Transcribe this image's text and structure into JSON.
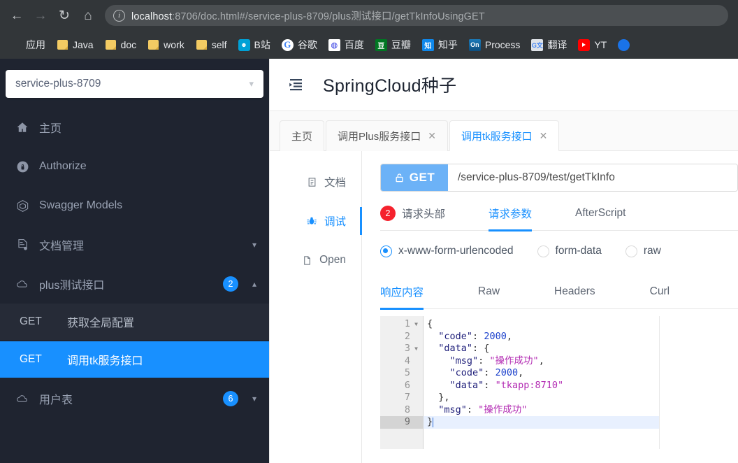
{
  "browser": {
    "back_icon": "back-arrow-icon",
    "forward_icon": "forward-arrow-icon",
    "reload_icon": "reload-icon",
    "home_icon": "home-icon",
    "url_host": "localhost",
    "url_rest": ":8706/doc.html#/service-plus-8709/plus测试接口/getTkInfoUsingGET",
    "url_full": "localhost:8706/doc.html#/service-plus-8709/plus测试接口/getTkInfoUsingGET",
    "site_info_icon": "info-circle-icon",
    "bookmarks": [
      {
        "label": "应用",
        "icon": "apps-grid-icon"
      },
      {
        "label": "Java",
        "icon": "folder-icon"
      },
      {
        "label": "doc",
        "icon": "folder-icon"
      },
      {
        "label": "work",
        "icon": "folder-icon"
      },
      {
        "label": "self",
        "icon": "folder-icon"
      },
      {
        "label": "B站",
        "icon": "bilibili-icon"
      },
      {
        "label": "谷歌",
        "icon": "google-icon"
      },
      {
        "label": "百度",
        "icon": "baidu-icon"
      },
      {
        "label": "豆瓣",
        "icon": "douban-icon"
      },
      {
        "label": "知乎",
        "icon": "zhihu-icon"
      },
      {
        "label": "Process",
        "icon": "on-process-icon"
      },
      {
        "label": "翻译",
        "icon": "google-translate-icon"
      },
      {
        "label": "YT",
        "icon": "youtube-icon"
      }
    ]
  },
  "sidebar": {
    "service_selected": "service-plus-8709",
    "nav": [
      {
        "label": "主页",
        "icon": "home-icon",
        "badge": null,
        "chevron": null
      },
      {
        "label": "Authorize",
        "icon": "lock-icon",
        "badge": null,
        "chevron": null
      },
      {
        "label": "Swagger Models",
        "icon": "cube-icon",
        "badge": null,
        "chevron": null
      },
      {
        "label": "文档管理",
        "icon": "doc-settings-icon",
        "badge": null,
        "chevron": "down"
      },
      {
        "label": "plus测试接口",
        "icon": "cloud-icon",
        "badge": "2",
        "chevron": "up"
      }
    ],
    "apis": [
      {
        "method": "GET",
        "name": "获取全局配置",
        "active": false
      },
      {
        "method": "GET",
        "name": "调用tk服务接口",
        "active": true
      }
    ],
    "nav_after": [
      {
        "label": "用户表",
        "icon": "cloud-icon",
        "badge": "6",
        "chevron": "down"
      }
    ]
  },
  "main": {
    "fold_icon": "menu-fold-icon",
    "title": "SpringCloud种子",
    "doc_tabs": [
      {
        "label": "主页",
        "closable": false,
        "active": false
      },
      {
        "label": "调用Plus服务接口",
        "closable": true,
        "active": false
      },
      {
        "label": "调用tk服务接口",
        "closable": true,
        "active": true
      }
    ],
    "tab_close_glyph": "✕",
    "side_tabs": [
      {
        "label": "文档",
        "icon": "document-icon",
        "active": false
      },
      {
        "label": "调试",
        "icon": "bug-icon",
        "active": true
      },
      {
        "label": "Open",
        "icon": "file-icon",
        "active": false
      }
    ],
    "request": {
      "method": "GET",
      "method_icon": "unlock-icon",
      "url": "/service-plus-8709/test/getTkInfo",
      "tabs": [
        {
          "label": "请求头部",
          "badge": "2",
          "active": false
        },
        {
          "label": "请求参数",
          "badge": null,
          "active": true
        },
        {
          "label": "AfterScript",
          "badge": null,
          "active": false
        }
      ],
      "body_types": [
        {
          "label": "x-www-form-urlencoded",
          "checked": true
        },
        {
          "label": "form-data",
          "checked": false
        },
        {
          "label": "raw",
          "checked": false
        }
      ]
    },
    "response": {
      "tabs": [
        {
          "label": "响应内容",
          "active": true
        },
        {
          "label": "Raw",
          "active": false
        },
        {
          "label": "Headers",
          "active": false
        },
        {
          "label": "Curl",
          "active": false
        }
      ],
      "editor": {
        "cursor_line": 9,
        "lines": [
          {
            "n": 1,
            "fold": true,
            "tokens": [
              {
                "t": "pun",
                "v": "{"
              }
            ]
          },
          {
            "n": 2,
            "fold": false,
            "tokens": [
              {
                "t": "pun",
                "v": "  "
              },
              {
                "t": "key",
                "v": "\"code\""
              },
              {
                "t": "pun",
                "v": ": "
              },
              {
                "t": "num",
                "v": "2000"
              },
              {
                "t": "pun",
                "v": ","
              }
            ]
          },
          {
            "n": 3,
            "fold": true,
            "tokens": [
              {
                "t": "pun",
                "v": "  "
              },
              {
                "t": "key",
                "v": "\"data\""
              },
              {
                "t": "pun",
                "v": ": {"
              }
            ]
          },
          {
            "n": 4,
            "fold": false,
            "tokens": [
              {
                "t": "pun",
                "v": "    "
              },
              {
                "t": "key",
                "v": "\"msg\""
              },
              {
                "t": "pun",
                "v": ": "
              },
              {
                "t": "str",
                "v": "\"操作成功\""
              },
              {
                "t": "pun",
                "v": ","
              }
            ]
          },
          {
            "n": 5,
            "fold": false,
            "tokens": [
              {
                "t": "pun",
                "v": "    "
              },
              {
                "t": "key",
                "v": "\"code\""
              },
              {
                "t": "pun",
                "v": ": "
              },
              {
                "t": "num",
                "v": "2000"
              },
              {
                "t": "pun",
                "v": ","
              }
            ]
          },
          {
            "n": 6,
            "fold": false,
            "tokens": [
              {
                "t": "pun",
                "v": "    "
              },
              {
                "t": "key",
                "v": "\"data\""
              },
              {
                "t": "pun",
                "v": ": "
              },
              {
                "t": "str",
                "v": "\"tkapp:8710\""
              }
            ]
          },
          {
            "n": 7,
            "fold": false,
            "tokens": [
              {
                "t": "pun",
                "v": "  },"
              }
            ]
          },
          {
            "n": 8,
            "fold": false,
            "tokens": [
              {
                "t": "pun",
                "v": "  "
              },
              {
                "t": "key",
                "v": "\"msg\""
              },
              {
                "t": "pun",
                "v": ": "
              },
              {
                "t": "str",
                "v": "\"操作成功\""
              }
            ]
          },
          {
            "n": 9,
            "fold": false,
            "tokens": [
              {
                "t": "pun",
                "v": "}"
              }
            ]
          }
        ]
      }
    }
  },
  "colors": {
    "accent": "#1890ff",
    "method_get": "#6cb2f7",
    "badge_red": "#f5222d",
    "sidebar_bg": "#1f2430",
    "chrome_bg": "#323639"
  }
}
